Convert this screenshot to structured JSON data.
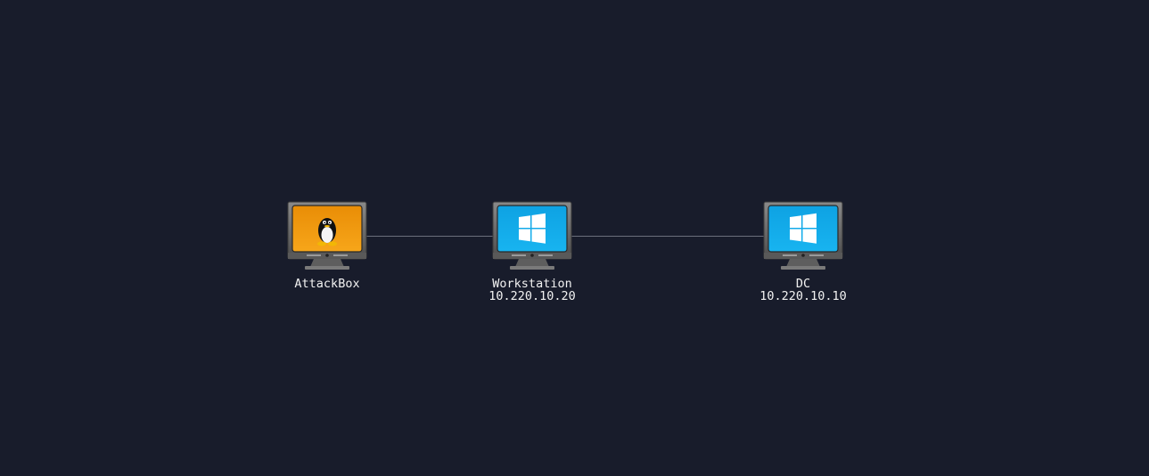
{
  "diagram": {
    "type": "network-topology",
    "background": "#181c2b",
    "link_color": "#6b6f7c",
    "nodes": [
      {
        "id": "attackbox",
        "name": "AttackBox",
        "ip": "",
        "os_icon": "linux-tux-icon",
        "screen_color": "#f39a0e"
      },
      {
        "id": "workstation",
        "name": "Workstation",
        "ip": "10.220.10.20",
        "os_icon": "windows-logo-icon",
        "screen_color": "#12a8e8"
      },
      {
        "id": "dc",
        "name": "DC",
        "ip": "10.220.10.10",
        "os_icon": "windows-logo-icon",
        "screen_color": "#12a8e8"
      }
    ],
    "links": [
      {
        "from": "attackbox",
        "to": "workstation"
      },
      {
        "from": "workstation",
        "to": "dc"
      }
    ]
  }
}
